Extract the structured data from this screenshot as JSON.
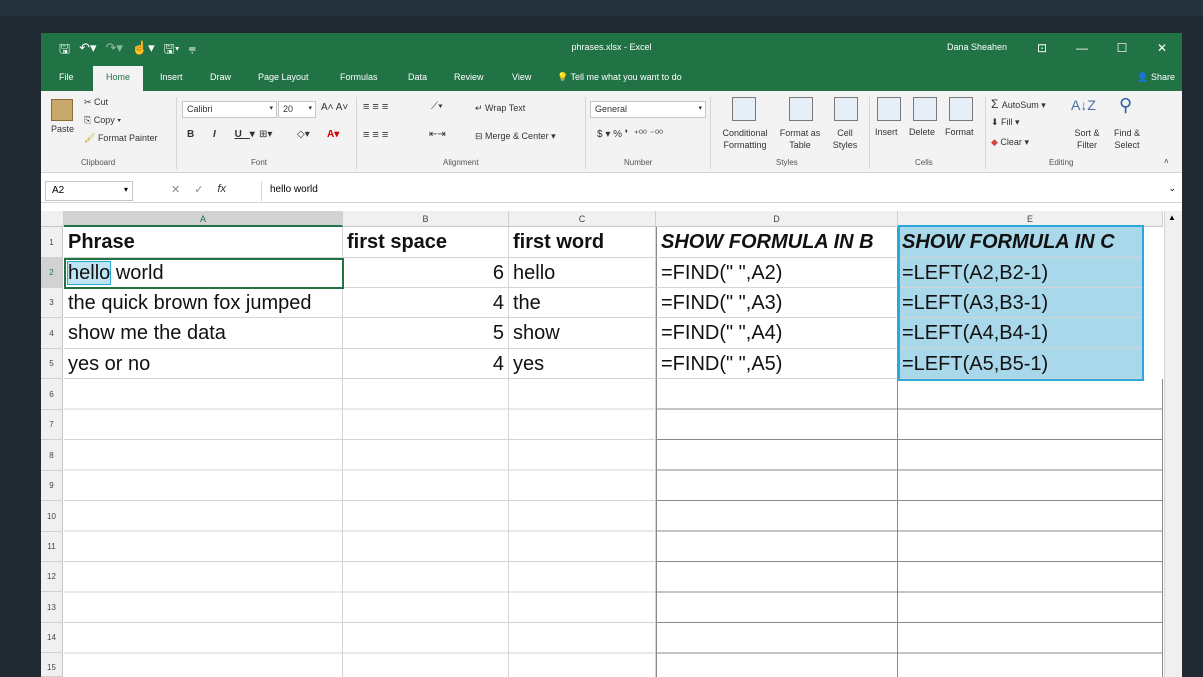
{
  "title": {
    "file": "phrases.xlsx - Excel",
    "user": "Dana Sheahen"
  },
  "tabs": [
    "File",
    "Home",
    "Insert",
    "Draw",
    "Page Layout",
    "Formulas",
    "Data",
    "Review",
    "View"
  ],
  "tell_me": "Tell me what you want to do",
  "share": "Share",
  "ribbon": {
    "clipboard": {
      "paste": "Paste",
      "cut": "Cut",
      "copy": "Copy",
      "format_painter": "Format Painter",
      "label": "Clipboard"
    },
    "font": {
      "name": "Calibri",
      "size": "20",
      "label": "Font"
    },
    "alignment": {
      "wrap": "Wrap Text",
      "merge": "Merge & Center",
      "label": "Alignment"
    },
    "number": {
      "format": "General",
      "label": "Number"
    },
    "styles": {
      "conditional": "Conditional Formatting",
      "format_table": "Format as Table",
      "cell_styles": "Cell Styles",
      "label": "Styles"
    },
    "cells": {
      "insert": "Insert",
      "delete": "Delete",
      "format": "Format",
      "label": "Cells"
    },
    "editing": {
      "autosum": "AutoSum",
      "fill": "Fill",
      "clear": "Clear",
      "sort": "Sort & Filter",
      "find": "Find & Select",
      "label": "Editing"
    }
  },
  "formula_bar": {
    "name_box": "A2",
    "value": "hello world"
  },
  "columns": [
    "A",
    "B",
    "C",
    "D",
    "E"
  ],
  "rows": [
    "1",
    "2",
    "3",
    "4",
    "5",
    "6",
    "7",
    "8",
    "9",
    "10",
    "11",
    "12",
    "13",
    "14",
    "15"
  ],
  "cells": {
    "r1": [
      "Phrase",
      "first space",
      "first word",
      "SHOW FORMULA IN B",
      "SHOW FORMULA IN C"
    ],
    "r2": [
      "hello world",
      "6",
      "hello",
      "=FIND(\" \",A2)",
      "=LEFT(A2,B2-1)"
    ],
    "r3": [
      "the quick brown fox jumped",
      "4",
      "the",
      "=FIND(\" \",A3)",
      "=LEFT(A3,B3-1)"
    ],
    "r4": [
      "show me the data",
      "5",
      "show",
      "=FIND(\" \",A4)",
      "=LEFT(A4,B4-1)"
    ],
    "r5": [
      "yes or no",
      "4",
      "yes",
      "=FIND(\" \",A5)",
      "=LEFT(A5,B5-1)"
    ]
  },
  "a2_parts": {
    "highlight": "hello",
    "rest": "world"
  },
  "colors": {
    "excel_green": "#217346",
    "selection_blue": "#2aa8d8",
    "selection_fill": "#a8d8ea"
  }
}
